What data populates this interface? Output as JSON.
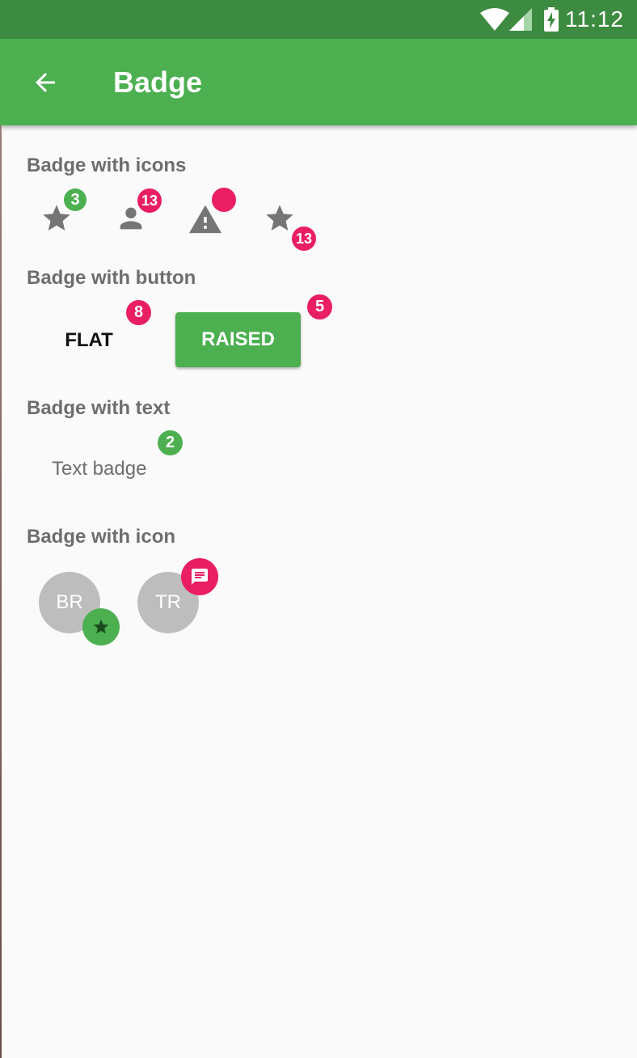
{
  "status_bar": {
    "time": "11:12",
    "icons": [
      "wifi-icon",
      "signal-icon",
      "battery-charging-icon"
    ],
    "color": "#3d8b40"
  },
  "app_bar": {
    "title": "Badge",
    "back_icon": "arrow-back-icon",
    "color": "#4caf50"
  },
  "sections": {
    "icons": {
      "title": "Badge with icons",
      "items": [
        {
          "icon": "star-icon",
          "badge": "3",
          "badge_color": "#4caf50"
        },
        {
          "icon": "person-icon",
          "badge": "13",
          "badge_color": "#e91e63"
        },
        {
          "icon": "warning-icon",
          "badge": "",
          "badge_color": "#e91e63"
        },
        {
          "icon": "star-icon",
          "badge": "13",
          "badge_color": "#e91e63"
        }
      ]
    },
    "button": {
      "title": "Badge with button",
      "flat_label": "FLAT",
      "flat_badge": "8",
      "raised_label": "RAISED",
      "raised_badge": "5"
    },
    "text": {
      "title": "Badge with text",
      "label": "Text badge",
      "badge": "2"
    },
    "icon": {
      "title": "Badge with icon",
      "avatars": [
        {
          "initials": "BR",
          "badge_icon": "star-icon",
          "badge_color": "#4caf50"
        },
        {
          "initials": "TR",
          "badge_icon": "message-icon",
          "badge_color": "#e91e63"
        }
      ]
    }
  },
  "colors": {
    "accent_pink": "#e91e63",
    "primary_green": "#4caf50",
    "dark_green": "#3d8b40",
    "avatar_grey": "#bdbdbd",
    "text_grey": "#6e6e6e",
    "background": "#fafafa"
  }
}
